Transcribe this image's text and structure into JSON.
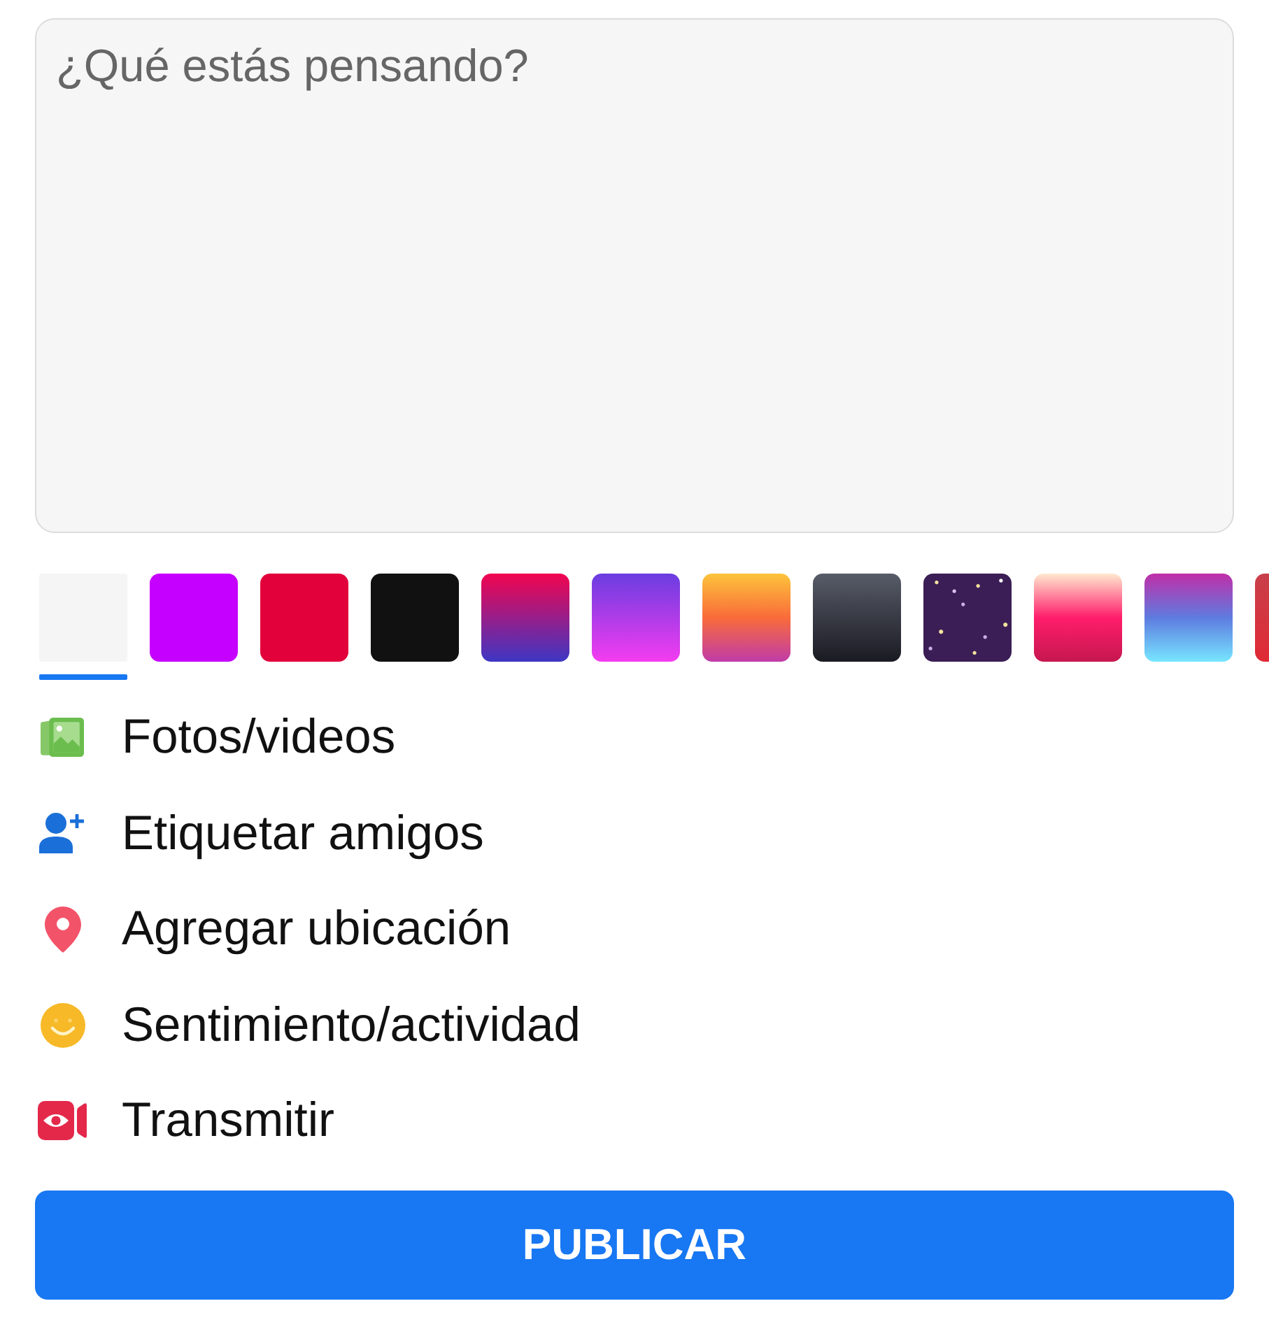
{
  "composer": {
    "placeholder": "¿Qué estás pensando?"
  },
  "backgrounds": [
    {
      "kind": "solid",
      "color": "#f5f5f5",
      "selected": true
    },
    {
      "kind": "solid",
      "color": "#c600ff",
      "selected": false
    },
    {
      "kind": "solid",
      "color": "#e2013b",
      "selected": false
    },
    {
      "kind": "solid",
      "color": "#111111",
      "selected": false
    },
    {
      "kind": "gradient",
      "stops": [
        {
          "color": "#f2054f"
        },
        {
          "color": "#3d37c4"
        }
      ],
      "selected": false
    },
    {
      "kind": "gradient",
      "stops": [
        {
          "color": "#6a3de0"
        },
        {
          "color": "#f43cf0"
        }
      ],
      "selected": false
    },
    {
      "kind": "gradient",
      "stops": [
        {
          "color": "#fdc43b"
        },
        {
          "color": "#f96b3a"
        },
        {
          "color": "#c03ba8"
        }
      ],
      "selected": false
    },
    {
      "kind": "gradient",
      "stops": [
        {
          "color": "#575c68"
        },
        {
          "color": "#1a1a22"
        }
      ],
      "selected": false
    },
    {
      "kind": "starry",
      "color": "#3a1e55",
      "selected": false
    },
    {
      "kind": "gradient",
      "stops": [
        {
          "color": "#ffe9cf"
        },
        {
          "color": "#ff1d6b"
        },
        {
          "color": "#c5174f"
        }
      ],
      "selected": false
    },
    {
      "kind": "gradient",
      "stops": [
        {
          "color": "#c02fa8"
        },
        {
          "color": "#5e7be0"
        },
        {
          "color": "#77e6ff"
        }
      ],
      "selected": false
    },
    {
      "kind": "gradient",
      "stops": [
        {
          "color": "#c8404a"
        },
        {
          "color": "#e02a35"
        }
      ],
      "selected": false
    }
  ],
  "actions": [
    {
      "kind": "photo",
      "label": "Fotos/videos"
    },
    {
      "kind": "tag",
      "label": "Etiquetar amigos"
    },
    {
      "kind": "location",
      "label": "Agregar ubicación"
    },
    {
      "kind": "feeling",
      "label": "Sentimiento/actividad"
    },
    {
      "kind": "live",
      "label": "Transmitir"
    }
  ],
  "publish_button": {
    "label": "PUBLICAR"
  }
}
